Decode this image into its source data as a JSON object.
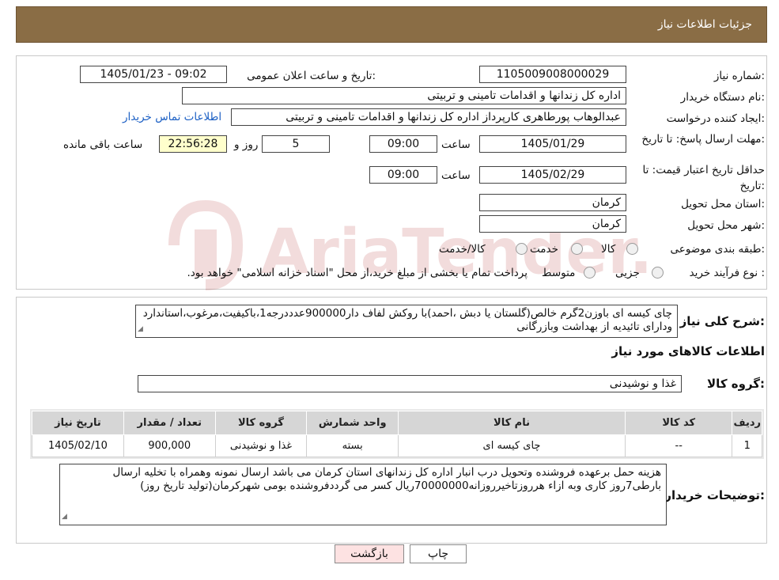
{
  "header": {
    "title": "جزئیات اطلاعات نیاز"
  },
  "form": {
    "need_number_label": "شماره نیاز:",
    "need_number": "1105009008000029",
    "announce_label": "تاریخ و ساعت اعلان عمومی:",
    "announce_value": "1405/01/23 - 09:02",
    "buyer_org_label": "نام دستگاه خریدار:",
    "buyer_org": "اداره کل زندانها و اقدامات تامینی و تربیتی",
    "creator_label": "ایجاد کننده درخواست:",
    "creator": "عبدالوهاب پورطاهری کارپرداز اداره کل زندانها و اقدامات تامینی و تربیتی",
    "contact_link": "اطلاعات تماس خریدار",
    "reply_deadline_label": "مهلت ارسال پاسخ: تا تاریخ:",
    "reply_date": "1405/01/29",
    "time_label": "ساعت",
    "reply_time": "09:00",
    "days_value": "5",
    "days_label": "روز و",
    "remaining_time": "22:56:28",
    "remaining_label": "ساعت باقی مانده",
    "validity_label": "حداقل تاریخ اعتبار قیمت: تا تاریخ:",
    "validity_date": "1405/02/29",
    "validity_time": "09:00",
    "province_label": "استان محل تحویل:",
    "province": "کرمان",
    "city_label": "شهر محل تحویل:",
    "city": "کرمان",
    "category_label": "طبقه بندی موضوعی:",
    "category_options": [
      "کالا",
      "خدمت",
      "کالا/خدمت"
    ],
    "process_label": "نوع فرآیند خرید :",
    "process_options": [
      "جزیی",
      "متوسط"
    ],
    "payment_note": "پرداخت تمام یا بخشی از مبلغ خرید،از محل \"اسناد خزانه اسلامی\" خواهد بود."
  },
  "summary": {
    "label": "شرح کلی نیاز:",
    "text": "چای کیسه ای باوزن2گرم خالص(گلستان یا دبش ،احمد)با روکش لفاف دار900000عدددرجه1،باکیفیت،مرغوب،استاندارد ودارای تائیدیه از بهداشت وبازرگانی"
  },
  "goods": {
    "section_title": "اطلاعات کالاهای مورد نیاز",
    "group_label": "گروه کالا:",
    "group_value": "غذا و نوشیدنی",
    "table": {
      "headers": [
        "ردیف",
        "کد کالا",
        "نام کالا",
        "واحد شمارش",
        "گروه کالا",
        "تعداد / مقدار",
        "تاریخ نیاز"
      ],
      "rows": [
        [
          "1",
          "--",
          "چای کیسه ای",
          "بسته",
          "غذا و نوشیدنی",
          "900,000",
          "1405/02/10"
        ]
      ]
    }
  },
  "buyer_notes": {
    "label": "توضیحات خریدار:",
    "text": "هزینه حمل برعهده فروشنده وتحویل درب انبار اداره کل زندانهای استان کرمان می باشد ارسال نمونه وهمراه با تخلیه ارسال بارطی7روز کاری وبه ازاء هرروزتاخیرروزانه70000000ریال کسر می گرددفروشنده بومی شهرکرمان(تولید تاریخ روز)"
  },
  "buttons": {
    "print": "چاپ",
    "back": "بازگشت"
  },
  "watermark": {
    "text": "AriaTender.neT"
  },
  "colors": {
    "header_bg": "#8a6d45",
    "link": "#1b5fc4",
    "remaining_bg": "#ffffcc",
    "back_button_bg": "#fde2e2"
  }
}
